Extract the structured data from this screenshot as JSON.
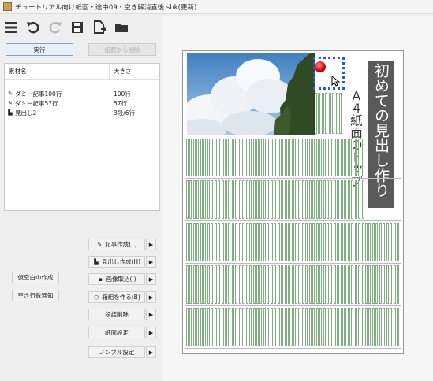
{
  "window": {
    "title": "チュートリアル向け紙面・途中09・空き解消直後.shk(更新)"
  },
  "toolbar": {
    "icons": [
      "menu-icon",
      "undo-icon",
      "redo-icon",
      "save-icon",
      "export-icon",
      "open-folder-icon"
    ]
  },
  "actions": {
    "execute": "実行",
    "remove_from_page": "紙面から削除"
  },
  "materials": {
    "headers": {
      "name": "素材名",
      "size": "大きさ"
    },
    "rows": [
      {
        "icon": "pencil-icon",
        "name": "ダミー記事100行",
        "size": "100行"
      },
      {
        "icon": "pencil-icon",
        "name": "ダミー記事57行",
        "size": "57行"
      },
      {
        "icon": "chart-icon",
        "name": "見出し2",
        "size": "3段/6行"
      }
    ]
  },
  "side_buttons": {
    "create_temp_space": "仮空白の作成",
    "empty_line_notice": "空き行数通知"
  },
  "commands": [
    {
      "icon": "pencil-icon",
      "label": "記事作成(T)"
    },
    {
      "icon": "chart-icon",
      "label": "見出し作成(H)"
    },
    {
      "icon": "image-icon",
      "label": "画像取込(I)"
    },
    {
      "icon": "box-icon",
      "label": "箱組を作る(B)"
    },
    {
      "icon": "",
      "label": "段詰削除"
    },
    {
      "icon": "",
      "label": "紙面設定"
    },
    {
      "icon": "",
      "label": "ノンブル設定"
    }
  ],
  "page": {
    "headline": "初めての見出し作り",
    "subheadline": "Ａ４紙面のトップ"
  },
  "colors": {
    "accent": "#1f5fd6",
    "headline_bg": "#5a5a5a",
    "column_line": "#7fae7f",
    "pin": "#d00000"
  }
}
